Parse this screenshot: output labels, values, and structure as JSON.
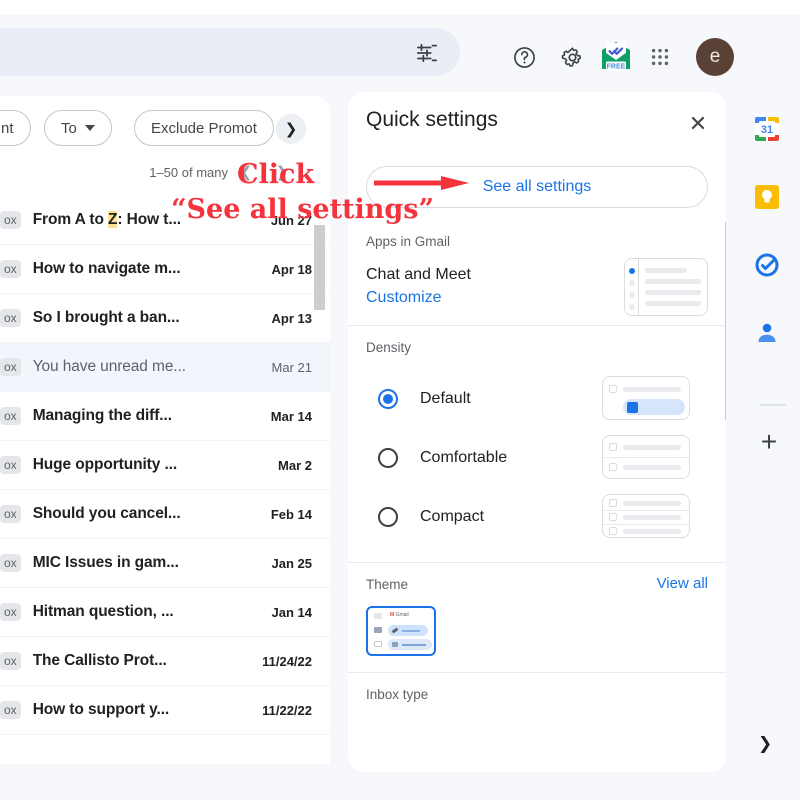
{
  "app": {
    "name": "Gmail",
    "accent_blue": "#1a73e8",
    "annotation_red": "#f4333d",
    "page_bg": "#f6f8fc"
  },
  "search": {
    "value": "",
    "placeholder": "",
    "tune_icon": "tune-icon"
  },
  "topbar": {
    "icons": [
      {
        "name": "help-icon",
        "glyph": "?"
      },
      {
        "name": "settings-gear-icon",
        "glyph": "gear"
      },
      {
        "name": "mail-tracker-free-icon",
        "glyph": "envelope",
        "badge": "FREE"
      },
      {
        "name": "google-apps-grid-icon",
        "glyph": "grid"
      }
    ],
    "avatar_letter": "e"
  },
  "mail_toolbar": {
    "chips": [
      {
        "label": "nt",
        "has_caret": false
      },
      {
        "label": "To",
        "has_caret": true
      },
      {
        "label": "Exclude Promot",
        "has_caret": false
      }
    ],
    "scroll_right_icon": "chevron-right-icon",
    "pager": {
      "range": "1–50 of many",
      "prev_icon": "chevron-left-icon",
      "next_icon": "chevron-right-icon"
    }
  },
  "mail_list": {
    "tag_label": "ox",
    "rows": [
      {
        "subject_pre": "From A to ",
        "highlight": "Z",
        "subject_post": ": How t...",
        "date": "Jun 27",
        "selected": false
      },
      {
        "subject": "How to navigate m...",
        "date": "Apr 18",
        "selected": false
      },
      {
        "subject": "So I brought a ban...",
        "date": "Apr 13",
        "selected": false
      },
      {
        "subject": "You have unread me...",
        "date": "Mar 21",
        "selected": true
      },
      {
        "subject": "Managing the diff...",
        "date": "Mar 14",
        "selected": false
      },
      {
        "subject": "Huge opportunity ...",
        "date": "Mar 2",
        "selected": false
      },
      {
        "subject": "Should you cancel...",
        "date": "Feb 14",
        "selected": false
      },
      {
        "subject": "MIC Issues in gam...",
        "date": "Jan 25",
        "selected": false
      },
      {
        "subject": "Hitman question, ...",
        "date": "Jan 14",
        "selected": false
      },
      {
        "subject": "The Callisto Prot...",
        "date": "11/24/22",
        "selected": false
      },
      {
        "subject": "How to support y...",
        "date": "11/22/22",
        "selected": false
      }
    ]
  },
  "quick_settings": {
    "title": "Quick settings",
    "close_icon": "close-icon",
    "see_all_settings": "See all settings",
    "apps_section": {
      "label": "Apps in Gmail",
      "row_label": "Chat and Meet",
      "link": "Customize"
    },
    "density_section": {
      "label": "Density",
      "options": [
        {
          "label": "Default",
          "selected": true
        },
        {
          "label": "Comfortable",
          "selected": false
        },
        {
          "label": "Compact",
          "selected": false
        }
      ]
    },
    "theme_section": {
      "label": "Theme",
      "view_all": "View all",
      "thumb_brand": "Gmail"
    },
    "inbox_type_section": {
      "label": "Inbox type"
    }
  },
  "right_rail": {
    "items": [
      {
        "name": "google-calendar-icon",
        "label": "31"
      },
      {
        "name": "google-keep-icon",
        "label": ""
      },
      {
        "name": "google-tasks-icon",
        "label": ""
      },
      {
        "name": "google-contacts-icon",
        "label": ""
      }
    ],
    "add_label": "+",
    "collapse_icon": "chevron-right-icon"
  },
  "annotations": {
    "line1": "Click",
    "line2": "“See all settings”",
    "arrow": "red-arrow-pointing-right"
  }
}
